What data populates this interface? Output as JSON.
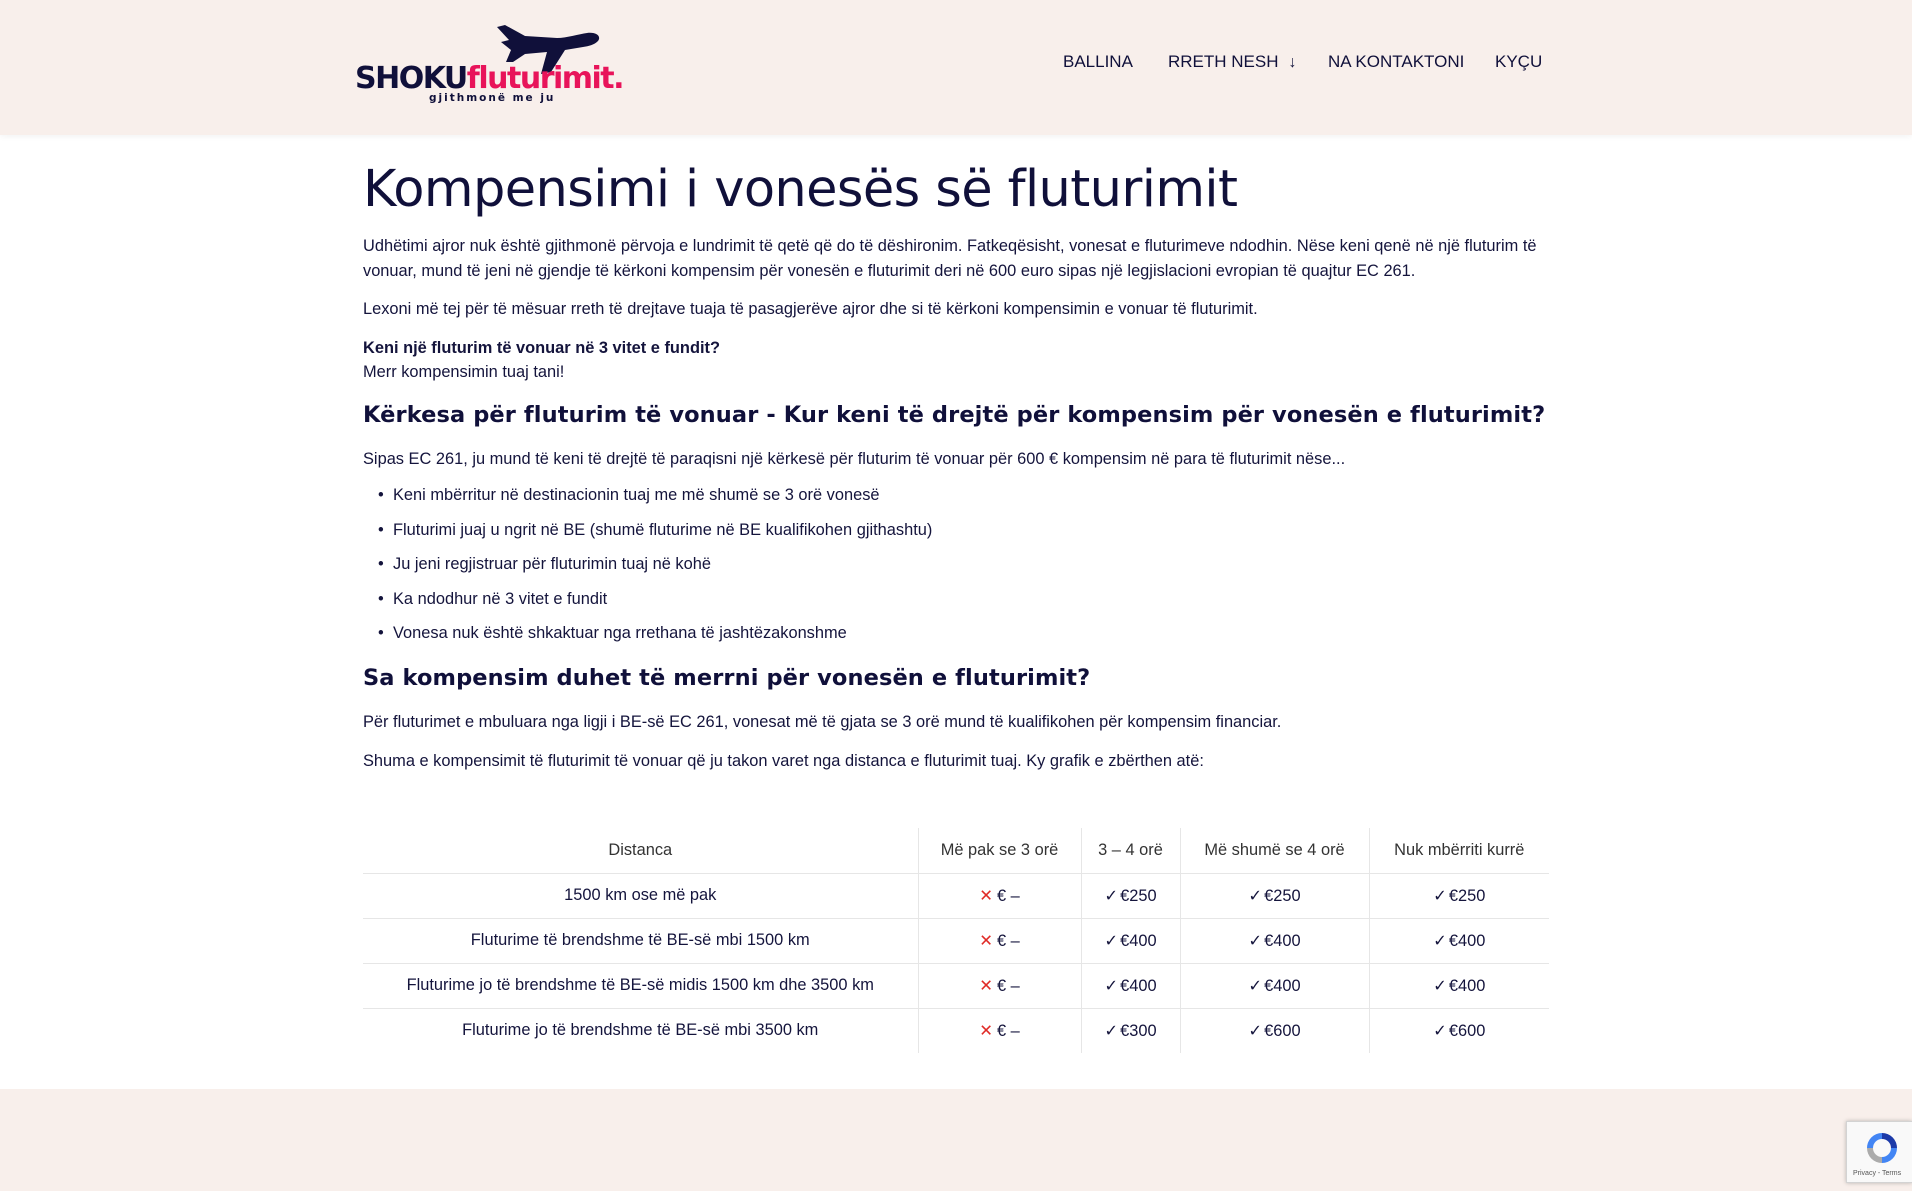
{
  "header": {
    "logo_part1": "SHOKU",
    "logo_part2": "fluturimit.",
    "logo_tagline": "gjithmonë me ju",
    "nav": [
      "BALLINA",
      "RRETH NESH",
      "NA KONTAKTONI",
      "KYÇU"
    ]
  },
  "main": {
    "title": "Kompensimi i vonesës së fluturimit",
    "intro": "Udhëtimi ajror nuk është gjithmonë përvoja e lundrimit të qetë që do të dëshironim. Fatkeqësisht, vonesat e fluturimeve ndodhin. Nëse keni qenë në një fluturim të vonuar, mund të jeni në gjendje të kërkoni kompensim për vonesën e fluturimit deri në 600 euro sipas një legjislacioni evropian të quajtur EC 261.",
    "intro2": "Lexoni më tej për të mësuar rreth të drejtave tuaja të pasagjerëve ajror dhe si të kërkoni kompensimin e vonuar të fluturimit.",
    "cta_question": "Keni një fluturim të vonuar në 3 vitet e fundit?",
    "cta_link": "Merr kompensimin tuaj tani!",
    "h2_1": "Kërkesa për fluturim të vonuar - Kur keni të drejtë për kompensim për vonesën e fluturimit?",
    "p_conditions": "Sipas EC 261, ju mund të keni të drejtë të paraqisni një kërkesë për fluturim të vonuar për 600 € kompensim në para të fluturimit nëse...",
    "conditions": [
      "Keni mbërritur në destinacionin tuaj me më shumë se 3 orë vonesë",
      "Fluturimi juaj u ngrit në BE (shumë fluturime në BE kualifikohen gjithashtu)",
      "Ju jeni regjistruar për fluturimin tuaj në kohë",
      "Ka ndodhur në 3 vitet e fundit",
      "Vonesa nuk është shkaktuar nga rrethana të jashtëzakonshme"
    ],
    "h2_2": "Sa kompensim duhet të merrni për vonesën e fluturimit?",
    "p_amount1": "Për fluturimet e mbuluara nga ligji i BE-së EC 261, vonesat më të gjata se 3 orë mund të kualifikohen për kompensim financiar.",
    "p_amount2": "Shuma e kompensimit të fluturimit të vonuar që ju takon varet nga distanca e fluturimit tuaj. Ky grafik e zbërthen atë:"
  },
  "table": {
    "headers": [
      "Distanca",
      "Më pak se 3 orë",
      "3 – 4 orë",
      "Më shumë se 4 orë",
      "Nuk mbërriti kurrë"
    ],
    "rows": [
      {
        "distance": "1500 km ose më pak",
        "c1": "€ –",
        "c2": "€250",
        "c3": "€250",
        "c4": "€250"
      },
      {
        "distance": "Fluturime të brendshme të BE-së mbi 1500 km",
        "c1": "€ –",
        "c2": "€400",
        "c3": "€400",
        "c4": "€400"
      },
      {
        "distance": "Fluturime jo të brendshme të BE-së midis 1500 km dhe 3500 km",
        "c1": "€ –",
        "c2": "€400",
        "c3": "€400",
        "c4": "€400"
      },
      {
        "distance": "Fluturime jo të brendshme të BE-së mbi 3500 km",
        "c1": "€ –",
        "c2": "€300",
        "c3": "€600",
        "c4": "€600"
      }
    ]
  },
  "recaptcha": {
    "footer_text": "Privacy - Terms"
  },
  "colors": {
    "brand_dark": "#10103a",
    "brand_pink": "#e8145a",
    "header_bg": "#f8efeb"
  }
}
